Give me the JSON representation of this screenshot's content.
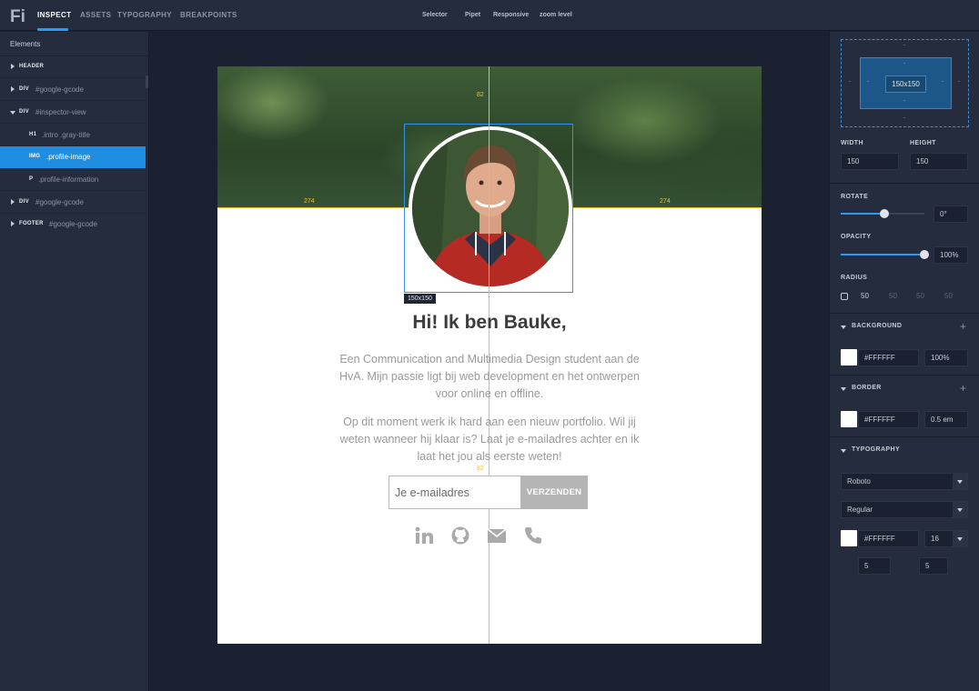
{
  "app": {
    "logo": "Fi"
  },
  "tabs": [
    {
      "label": "INSPECT",
      "active": true
    },
    {
      "label": "ASSETS",
      "active": false
    },
    {
      "label": "TYPOGRAPHY",
      "active": false
    },
    {
      "label": "BREAKPOINTS",
      "active": false
    }
  ],
  "tools": [
    "Selector",
    "Pipet",
    "Responsive",
    "zoom level"
  ],
  "elements_panel": {
    "title": "Elements",
    "tree": [
      {
        "tag": "HEADER",
        "selector": "",
        "expanded": false,
        "depth": 0,
        "selected": false
      },
      {
        "tag": "DIV",
        "selector": "#google-gcode",
        "expanded": false,
        "depth": 0,
        "selected": false
      },
      {
        "tag": "DIV",
        "selector": "#inspector-view",
        "expanded": true,
        "depth": 0,
        "selected": false
      },
      {
        "tag": "H1",
        "selector": ".intro .gray-title",
        "depth": 1,
        "selected": false
      },
      {
        "tag": "IMG",
        "selector": ".profile-image",
        "depth": 1,
        "selected": true
      },
      {
        "tag": "P",
        "selector": ".profile-information",
        "depth": 1,
        "selected": false
      },
      {
        "tag": "DIV",
        "selector": "#google-gcode",
        "expanded": false,
        "depth": 0,
        "selected": false
      },
      {
        "tag": "FOOTER",
        "selector": "#google-gcode",
        "expanded": false,
        "depth": 0,
        "selected": false
      }
    ]
  },
  "canvas": {
    "measure_top": "82",
    "measure_left": "274",
    "measure_right": "274",
    "measure_bottom": "82",
    "selection_size": "150x150",
    "headline": "Hi! Ik ben Bauke,",
    "paragraph_1": "Een Communication and Multimedia Design student aan de HvA. Mijn passie ligt bij web development en het ontwerpen voor online en offline.",
    "paragraph_2": "Op dit moment werk ik hard aan een nieuw portfolio. Wil jij weten wanneer hij klaar is? Laat je e-mailadres achter en ik laat het jou als eerste weten!",
    "email_placeholder": "Je e-mailadres",
    "submit_label": "VERZENDEN",
    "social_icons": [
      "linkedin-icon",
      "github-icon",
      "mail-icon",
      "phone-icon"
    ]
  },
  "inspector": {
    "box_model": {
      "content": "150x150",
      "margin": "-",
      "padding": "-"
    },
    "width_label": "WIDTH",
    "height_label": "HEIGHT",
    "width": "150",
    "height": "150",
    "rotate_label": "ROTATE",
    "rotate_value": "0°",
    "rotate_fraction": 0.52,
    "opacity_label": "OPACITY",
    "opacity_value": "100%",
    "opacity_fraction": 1.0,
    "radius_label": "RADIUS",
    "radius_values": [
      "50",
      "50",
      "50",
      "50"
    ],
    "background": {
      "label": "BACKGROUND",
      "color": "#FFFFFF",
      "opacity": "100%"
    },
    "border": {
      "label": "BORDER",
      "color": "#FFFFFF",
      "width": "0.5 em"
    },
    "typography": {
      "label": "TYPOGRAPHY",
      "font": "Roboto",
      "weight": "Regular",
      "color": "#FFFFFF",
      "size": "16",
      "value_a": "5",
      "value_b": "5"
    }
  },
  "colors": {
    "accent": "#2a9bf0",
    "guide": "#e6c040"
  }
}
